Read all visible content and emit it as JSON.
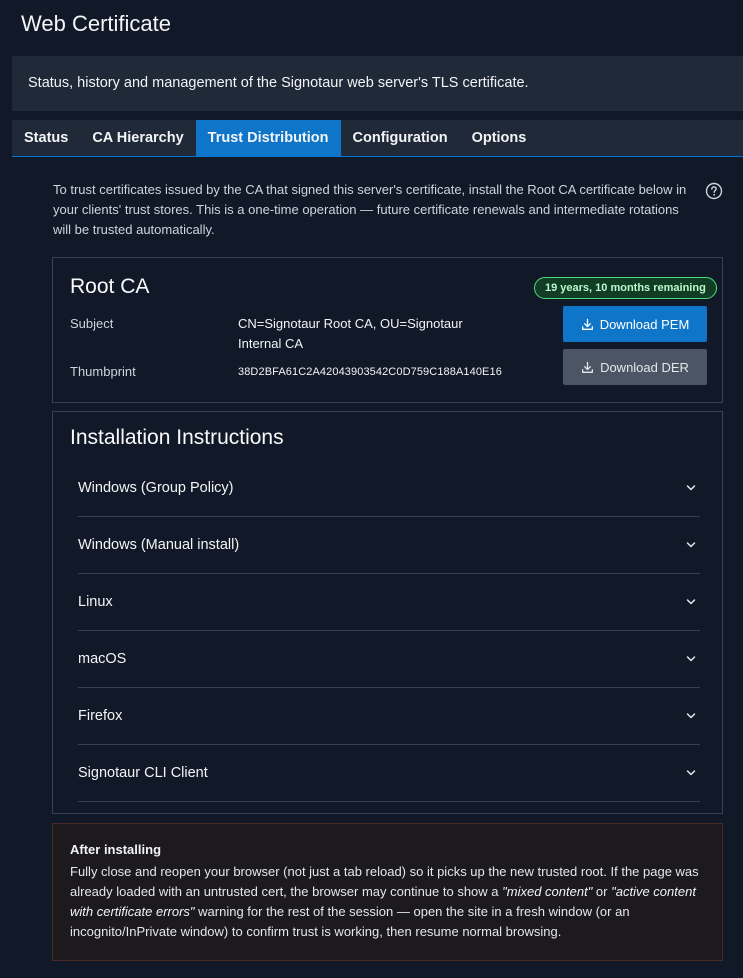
{
  "page": {
    "title": "Web Certificate",
    "description": "Status, history and management of the Signotaur web server's TLS certificate."
  },
  "tabs": [
    {
      "label": "Status",
      "active": false
    },
    {
      "label": "CA Hierarchy",
      "active": false
    },
    {
      "label": "Trust Distribution",
      "active": true
    },
    {
      "label": "Configuration",
      "active": false
    },
    {
      "label": "Options",
      "active": false
    }
  ],
  "intro": "To trust certificates issued by the CA that signed this server's certificate, install the Root CA certificate below in your clients' trust stores. This is a one-time operation — future certificate renewals and intermediate rotations will be trusted automatically.",
  "root_ca": {
    "title": "Root CA",
    "badge": "19 years, 10 months remaining",
    "subject_label": "Subject",
    "subject_value": "CN=Signotaur Root CA, OU=Signotaur Internal CA",
    "thumbprint_label": "Thumbprint",
    "thumbprint_value": "38D2BFA61C2A42043903542C0D759C188A140E16",
    "download_pem": "Download PEM",
    "download_der": "Download DER"
  },
  "instructions": {
    "title": "Installation Instructions",
    "items": [
      "Windows (Group Policy)",
      "Windows (Manual install)",
      "Linux",
      "macOS",
      "Firefox",
      "Signotaur CLI Client"
    ]
  },
  "notice": {
    "title": "After installing",
    "body_1": "Fully close and reopen your browser (not just a tab reload) so it picks up the new trusted root. If the page was already loaded with an untrusted cert, the browser may continue to show a ",
    "quote_1": "\"mixed content\"",
    "body_2": " or ",
    "quote_2": "\"active content with certificate errors\"",
    "body_3": " warning for the rest of the session — open the site in a fresh window (or an incognito/InPrivate window) to confirm trust is working, then resume normal browsing."
  },
  "colors": {
    "background": "#111827",
    "accent": "#0f75c9",
    "badge_border": "#4ade80"
  }
}
